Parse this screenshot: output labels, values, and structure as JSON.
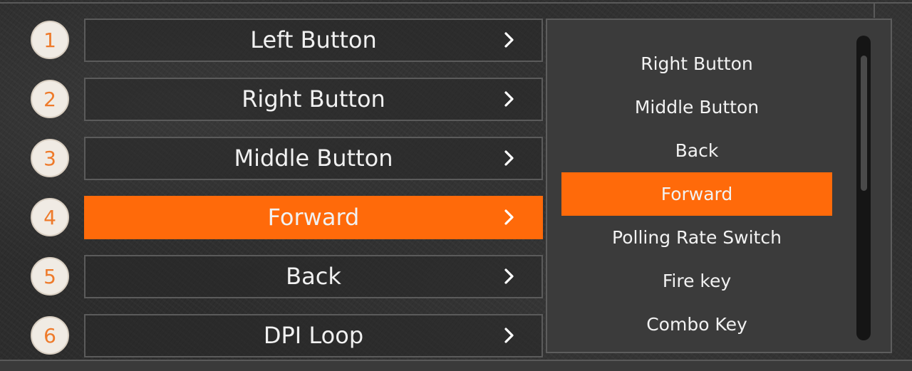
{
  "colors": {
    "accent": "#ff6a0a",
    "badge_number": "#ee7a2a",
    "badge_bg": "#f0ebe4",
    "panel_bg": "#3b3b3b",
    "text": "#f1f1f1"
  },
  "buttons": [
    {
      "number": "1",
      "label": "Left Button",
      "active": false
    },
    {
      "number": "2",
      "label": "Right Button",
      "active": false
    },
    {
      "number": "3",
      "label": "Middle Button",
      "active": false
    },
    {
      "number": "4",
      "label": "Forward",
      "active": true
    },
    {
      "number": "5",
      "label": "Back",
      "active": false
    },
    {
      "number": "6",
      "label": "DPI Loop",
      "active": false
    }
  ],
  "dropdown": {
    "options": [
      {
        "label": "Right Button",
        "selected": false
      },
      {
        "label": "Middle Button",
        "selected": false
      },
      {
        "label": "Back",
        "selected": false
      },
      {
        "label": "Forward",
        "selected": true
      },
      {
        "label": "Polling Rate Switch",
        "selected": false
      },
      {
        "label": "Fire key",
        "selected": false
      },
      {
        "label": "Combo Key",
        "selected": false
      }
    ],
    "scroll_position_fraction": 0.0
  },
  "icons": {
    "row_arrow": "chevron-right-icon"
  }
}
